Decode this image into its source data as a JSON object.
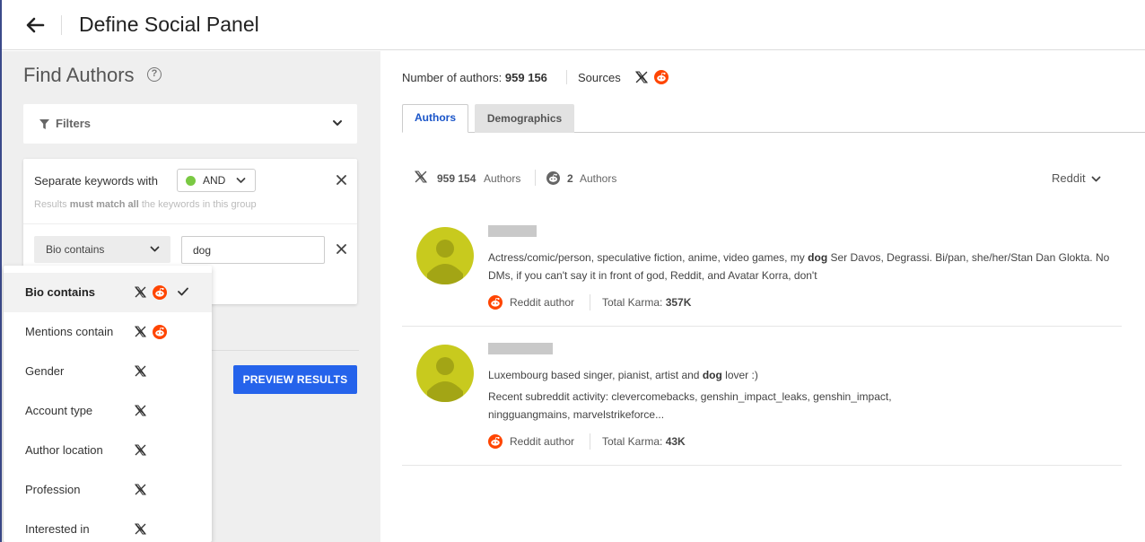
{
  "header": {
    "title": "Define Social Panel"
  },
  "left": {
    "title": "Find Authors",
    "filters_label": "Filters",
    "group": {
      "separate_label": "Separate keywords with",
      "operator": "AND",
      "hint_prefix": "Results ",
      "hint_bold": "must match all",
      "hint_suffix": " the keywords in this group",
      "field_selected": "Bio contains",
      "keyword_value": "dog",
      "keyword_placeholder": ""
    },
    "preview_button": "PREVIEW RESULTS",
    "menu": [
      {
        "label": "Bio contains",
        "sources": [
          "x",
          "reddit"
        ],
        "selected": true
      },
      {
        "label": "Mentions contain",
        "sources": [
          "x",
          "reddit"
        ],
        "selected": false
      },
      {
        "label": "Gender",
        "sources": [
          "x"
        ],
        "selected": false
      },
      {
        "label": "Account type",
        "sources": [
          "x"
        ],
        "selected": false
      },
      {
        "label": "Author location",
        "sources": [
          "x"
        ],
        "selected": false
      },
      {
        "label": "Profession",
        "sources": [
          "x"
        ],
        "selected": false
      },
      {
        "label": "Interested in",
        "sources": [
          "x"
        ],
        "selected": false
      }
    ]
  },
  "right": {
    "num_authors_label": "Number of authors:",
    "num_authors_value": "959 156",
    "sources_label": "Sources",
    "tabs": [
      {
        "label": "Authors",
        "active": true
      },
      {
        "label": "Demographics",
        "active": false
      }
    ],
    "stats": {
      "x_count": "959 154",
      "x_label": "Authors",
      "reddit_count": "2",
      "reddit_label": "Authors"
    },
    "source_filter": "Reddit",
    "authors": [
      {
        "bio_parts": [
          "Actress/comic/person, speculative fiction, anime, video games, my ",
          "dog",
          " Ser Davos, Degrassi. Bi/pan, she/her/Stan Dan Glokta. No DMs, if you can't say it in front of god, Reddit, and Avatar Korra, don't"
        ],
        "activity": "",
        "source_label": "Reddit author",
        "karma_label": "Total Karma:",
        "karma_value": "357K"
      },
      {
        "bio_parts": [
          "Luxembourg based singer, pianist, artist and ",
          "dog",
          " lover :)"
        ],
        "activity": "Recent subreddit activity: clevercomebacks, genshin_impact_leaks, genshin_impact, ningguangmains, marvelstrikeforce...",
        "source_label": "Reddit author",
        "karma_label": "Total Karma:",
        "karma_value": "43K"
      }
    ]
  },
  "colors": {
    "accent": "#2563eb",
    "reddit": "#ff4500",
    "avatar": "#c8ca1e",
    "and_dot": "#7ac943"
  }
}
